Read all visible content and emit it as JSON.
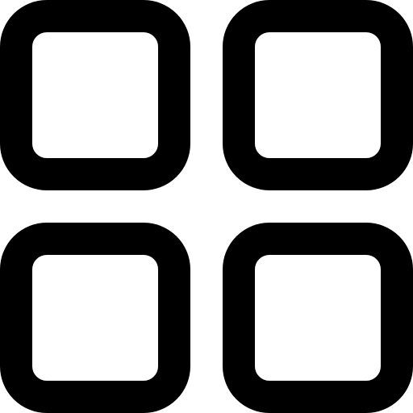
{
  "icon": {
    "name": "grid-icon",
    "color": "#000000",
    "background": "#ffffff",
    "tiles": [
      {
        "name": "grid-tile-top-left-icon"
      },
      {
        "name": "grid-tile-top-right-icon"
      },
      {
        "name": "grid-tile-bottom-left-icon"
      },
      {
        "name": "grid-tile-bottom-right-icon"
      }
    ]
  }
}
